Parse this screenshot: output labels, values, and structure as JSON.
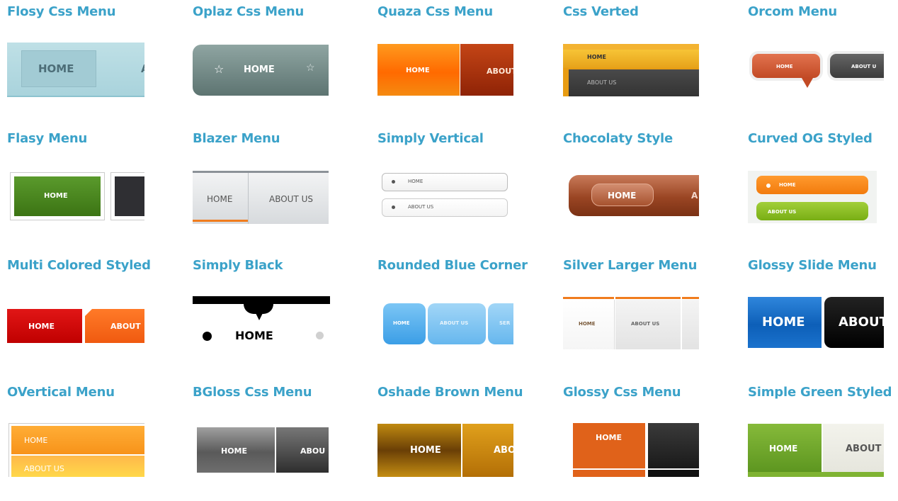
{
  "menus": [
    {
      "title": "Flosy Css Menu",
      "labels": [
        "HOME",
        "A"
      ]
    },
    {
      "title": "Oplaz Css Menu",
      "labels": [
        "HOME"
      ]
    },
    {
      "title": "Quaza Css Menu",
      "labels": [
        "HOME",
        "ABOUT"
      ]
    },
    {
      "title": "Css Verted",
      "labels": [
        "HOME",
        "ABOUT US"
      ]
    },
    {
      "title": "Orcom Menu",
      "labels": [
        "HOME",
        "ABOUT U"
      ]
    },
    {
      "title": "Flasy Menu",
      "labels": [
        "HOME"
      ]
    },
    {
      "title": "Blazer Menu",
      "labels": [
        "HOME",
        "ABOUT US"
      ]
    },
    {
      "title": "Simply Vertical",
      "labels": [
        "HOME",
        "ABOUT US"
      ]
    },
    {
      "title": "Chocolaty Style",
      "labels": [
        "HOME",
        "A"
      ]
    },
    {
      "title": "Curved OG Styled",
      "labels": [
        "HOME",
        "ABOUT US"
      ]
    },
    {
      "title": "Multi Colored Styled",
      "labels": [
        "HOME",
        "ABOUT"
      ]
    },
    {
      "title": "Simply Black",
      "labels": [
        "HOME"
      ]
    },
    {
      "title": "Rounded Blue Corner",
      "labels": [
        "HOME",
        "ABOUT US",
        "SER"
      ]
    },
    {
      "title": "Silver Larger Menu",
      "labels": [
        "HOME",
        "ABOUT US"
      ]
    },
    {
      "title": "Glossy Slide Menu",
      "labels": [
        "HOME",
        "ABOUT"
      ]
    },
    {
      "title": "OVertical Menu",
      "labels": [
        "HOME",
        "ABOUT US"
      ]
    },
    {
      "title": "BGloss Css Menu",
      "labels": [
        "HOME",
        "ABOU"
      ]
    },
    {
      "title": "Oshade Brown Menu",
      "labels": [
        "HOME",
        "ABO"
      ]
    },
    {
      "title": "Glossy Css Menu",
      "labels": [
        "HOME"
      ]
    },
    {
      "title": "Simple Green Styled",
      "labels": [
        "HOME",
        "ABOUT"
      ]
    }
  ],
  "colors": {
    "title": "#3ba2c9"
  }
}
